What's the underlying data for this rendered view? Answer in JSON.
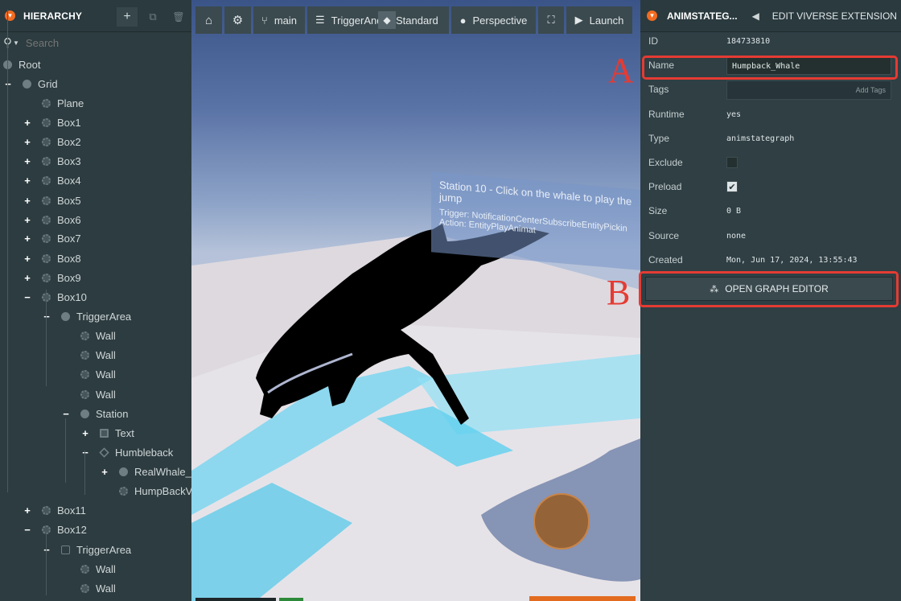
{
  "hierarchy": {
    "title": "HIERARCHY",
    "add_icon": "+",
    "duplicate_icon": "⧉",
    "delete_icon": "🗑",
    "search_placeholder": "Search",
    "nodes": [
      {
        "label": "Root",
        "toggle": "",
        "icon": "entity"
      },
      {
        "label": "Grid",
        "toggle": "−",
        "icon": "entity"
      },
      {
        "label": "Plane",
        "toggle": "",
        "icon": "gear"
      },
      {
        "label": "Box1",
        "toggle": "+",
        "icon": "gear"
      },
      {
        "label": "Box2",
        "toggle": "+",
        "icon": "gear"
      },
      {
        "label": "Box3",
        "toggle": "+",
        "icon": "gear"
      },
      {
        "label": "Box4",
        "toggle": "+",
        "icon": "gear"
      },
      {
        "label": "Box5",
        "toggle": "+",
        "icon": "gear"
      },
      {
        "label": "Box6",
        "toggle": "+",
        "icon": "gear"
      },
      {
        "label": "Box7",
        "toggle": "+",
        "icon": "gear"
      },
      {
        "label": "Box8",
        "toggle": "+",
        "icon": "gear"
      },
      {
        "label": "Box9",
        "toggle": "+",
        "icon": "gear"
      },
      {
        "label": "Box10",
        "toggle": "−",
        "icon": "gear"
      },
      {
        "label": "TriggerArea",
        "toggle": "−",
        "icon": "entity"
      },
      {
        "label": "Wall",
        "toggle": "",
        "icon": "gear"
      },
      {
        "label": "Wall",
        "toggle": "",
        "icon": "gear"
      },
      {
        "label": "Wall",
        "toggle": "",
        "icon": "gear"
      },
      {
        "label": "Wall",
        "toggle": "",
        "icon": "gear"
      },
      {
        "label": "Station",
        "toggle": "−",
        "icon": "entity"
      },
      {
        "label": "Text",
        "toggle": "+",
        "icon": "square"
      },
      {
        "label": "Humbleback",
        "toggle": "−",
        "icon": "diamond"
      },
      {
        "label": "RealWhale_",
        "toggle": "+",
        "icon": "entity"
      },
      {
        "label": "HumpBackV",
        "toggle": "",
        "icon": "gear"
      },
      {
        "label": "Box11",
        "toggle": "+",
        "icon": "gear"
      },
      {
        "label": "Box12",
        "toggle": "−",
        "icon": "gear"
      },
      {
        "label": "TriggerArea",
        "toggle": "−",
        "icon": "cube"
      },
      {
        "label": "Wall",
        "toggle": "",
        "icon": "gear"
      },
      {
        "label": "Wall",
        "toggle": "",
        "icon": "gear"
      }
    ]
  },
  "toolbar": {
    "home_icon": "⌂",
    "settings_icon": "⚙",
    "branch_label": "main",
    "branch_icon": "⑂",
    "scene_label": "TriggerAnd",
    "scene_icon": "☰",
    "render_label": "Standard",
    "render_icon": "◆",
    "camera_label": "Perspective",
    "camera_icon": "●",
    "fullscreen_icon": "⛶",
    "launch_label": "Launch",
    "launch_icon": "▶"
  },
  "viewport": {
    "station_title": "Station 10 - Click on the whale to play the jump",
    "station_trigger": "Trigger: NotificationCenterSubscribeEntityPickin",
    "station_action": "Action: EntityPlayAnimat"
  },
  "inspector": {
    "title": "ANIMSTATEG...",
    "back_icon": "◀",
    "extension_label": "EDIT VIVERSE EXTENSION",
    "id_label": "ID",
    "id_value": "184733810",
    "name_label": "Name",
    "name_value": "Humpback_Whale",
    "tags_label": "Tags",
    "tags_placeholder": "Add Tags",
    "runtime_label": "Runtime",
    "runtime_value": "yes",
    "type_label": "Type",
    "type_value": "animstategraph",
    "exclude_label": "Exclude",
    "exclude_checked": false,
    "preload_label": "Preload",
    "preload_checked": true,
    "preload_check_icon": "✔",
    "size_label": "Size",
    "size_value": "0 B",
    "source_label": "Source",
    "source_value": "none",
    "created_label": "Created",
    "created_value": "Mon, Jun 17, 2024, 13:55:43",
    "graph_button_label": "OPEN GRAPH EDITOR",
    "graph_button_icon": "⁂"
  },
  "annotations": {
    "a_letter": "A",
    "b_letter": "B",
    "color": "#e53b33"
  },
  "colors": {
    "accent": "#f36b21",
    "panel": "#2d3c40",
    "annotation": "#e53b33"
  }
}
